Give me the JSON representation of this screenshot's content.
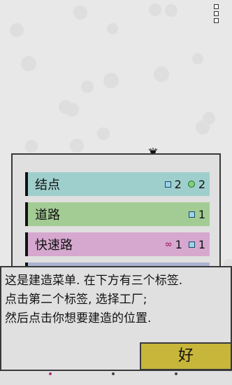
{
  "build_menu": {
    "items": [
      {
        "label": "结点",
        "color": "#9fcfcc",
        "resources": [
          {
            "icon": "square-node-icon",
            "value": "2"
          },
          {
            "icon": "circle-node-icon",
            "value": "2"
          }
        ]
      },
      {
        "label": "道路",
        "color": "#a3cc94",
        "resources": [
          {
            "icon": "square-node-icon",
            "value": "1"
          }
        ]
      },
      {
        "label": "快速路",
        "color": "#d6a8cf",
        "resources": [
          {
            "icon": "infinity-icon",
            "value": "1"
          },
          {
            "icon": "square-node-icon",
            "value": "1"
          }
        ]
      }
    ]
  },
  "tutorial": {
    "message": "这是建造菜单. 在下方有三个标签.\n点击第二个标签, 选择工厂;\n然后点击你想要建造的位置.",
    "ok_label": "好"
  },
  "colors": {
    "ok_button": "#c8b63a",
    "background": "#e8e8e8"
  }
}
